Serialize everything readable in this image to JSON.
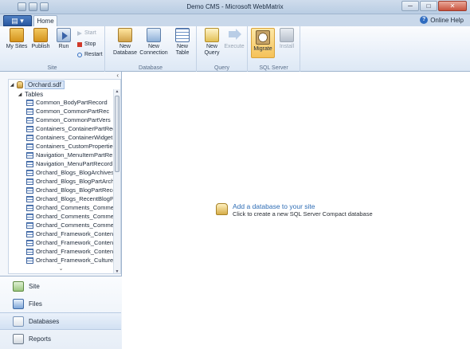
{
  "window": {
    "title": "Demo CMS - Microsoft WebMatrix",
    "minimize": "─",
    "maximize": "□",
    "close": "✕"
  },
  "tabs": {
    "app_menu": "▤ ▾",
    "home": "Home"
  },
  "help": {
    "icon": "?",
    "label": "Online Help"
  },
  "ribbon": {
    "site_group": {
      "label": "Site",
      "my_sites": "My Sites",
      "publish": "Publish",
      "run": "Run",
      "start": "Start",
      "stop": "Stop",
      "restart": "Restart"
    },
    "database_group": {
      "label": "Database",
      "new_database": "New Database",
      "new_connection": "New Connection",
      "new_table": "New Table"
    },
    "query_group": {
      "label": "Query",
      "new_query": "New Query",
      "execute": "Execute"
    },
    "sqlserver_group": {
      "label": "SQL Server",
      "migrate": "Migrate",
      "install": "Install"
    }
  },
  "tree": {
    "collapse_glyph": "‹",
    "root": "Orchard.sdf",
    "tables_label": "Tables",
    "tables": [
      "Common_BodyPartRecord",
      "Common_CommonPartRec",
      "Common_CommonPartVers",
      "Containers_ContainerPartRec",
      "Containers_ContainerWidget",
      "Containers_CustomPropertie",
      "Navigation_MenuItemPartRe",
      "Navigation_MenuPartRecord",
      "Orchard_Blogs_BlogArchives",
      "Orchard_Blogs_BlogPartArch",
      "Orchard_Blogs_BlogPartRecord",
      "Orchard_Blogs_RecentBlogPo",
      "Orchard_Comments_Comme",
      "Orchard_Comments_Comme",
      "Orchard_Comments_Comme",
      "Orchard_Framework_Conten",
      "Orchard_Framework_Conten",
      "Orchard_Framework_Conten",
      "Orchard_Framework_Culture"
    ],
    "more_glyph": "⌄"
  },
  "workspaces": [
    {
      "label": "Site",
      "icon": "site-icon",
      "selected": false
    },
    {
      "label": "Files",
      "icon": "files-icon",
      "selected": false
    },
    {
      "label": "Databases",
      "icon": "databases-icon",
      "selected": true
    },
    {
      "label": "Reports",
      "icon": "reports-icon",
      "selected": false
    }
  ],
  "main": {
    "add_db_title": "Add a database to your site",
    "add_db_subtitle": "Click to create a new SQL Server Compact database"
  },
  "colors": {
    "accent": "#2e6db5",
    "ribbon_bg": "#e6eef8",
    "title_bar": "#c9d8ea",
    "active_button": "#f5c158"
  }
}
